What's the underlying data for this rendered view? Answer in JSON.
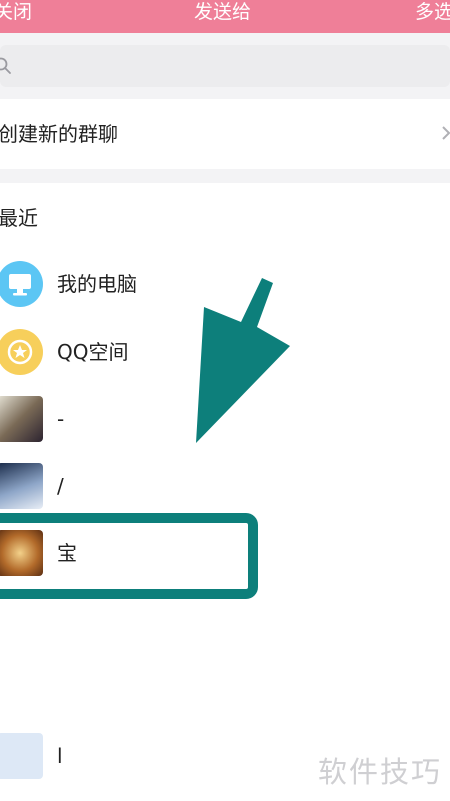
{
  "header": {
    "close_label": "关闭",
    "title": "发送给",
    "multi_label": "多选"
  },
  "search": {
    "icon": "search-icon"
  },
  "create_group": {
    "label": "创建新的群聊",
    "icon": "chevron-right-icon"
  },
  "recent": {
    "title": "最近",
    "items": [
      {
        "name": "我的电脑",
        "avatar": "monitor-icon"
      },
      {
        "name": "QQ空间",
        "avatar": "star-icon"
      },
      {
        "name": "-",
        "avatar": "photo-avatar"
      },
      {
        "name": "/",
        "avatar": "photo-avatar"
      },
      {
        "name": "宝",
        "avatar": "photo-avatar"
      },
      {
        "name": "l",
        "avatar": "photo-avatar"
      }
    ]
  },
  "overlay": {
    "watermark": "软件技巧",
    "arrow_color": "#0d7f7b",
    "box_color": "#0d7f7b"
  },
  "colors": {
    "header_bg": "#ef7f98",
    "pc_avatar": "#5cc6f4",
    "qzone_avatar": "#f7cf5b"
  }
}
